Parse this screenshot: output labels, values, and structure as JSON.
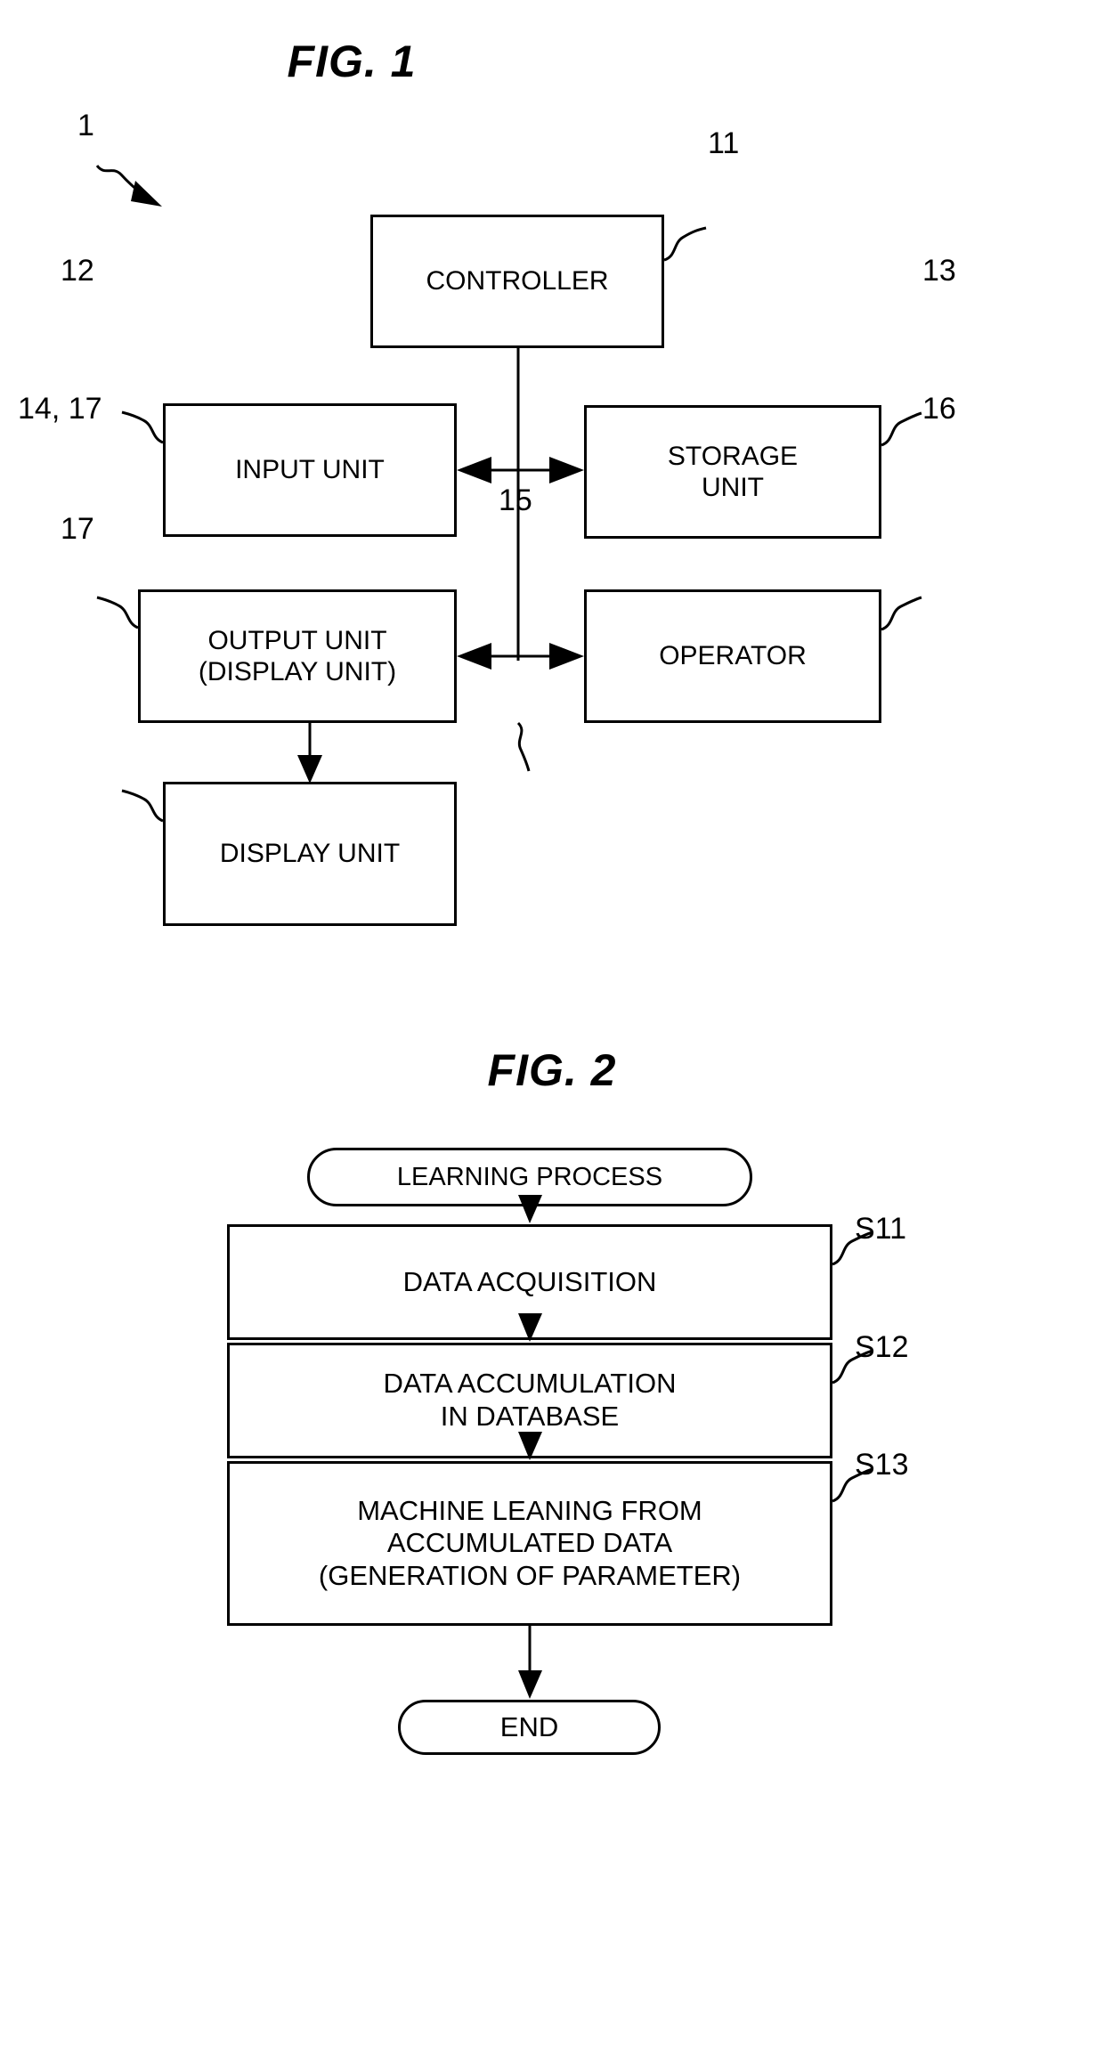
{
  "figures": [
    {
      "title": "FIG. 1",
      "type": "block-diagram",
      "system_ref": "1",
      "blocks": [
        {
          "id": "controller",
          "label": "CONTROLLER",
          "ref": "11"
        },
        {
          "id": "input-unit",
          "label": "INPUT UNIT",
          "ref": "12"
        },
        {
          "id": "storage-unit",
          "label": "STORAGE\nUNIT",
          "ref": "13"
        },
        {
          "id": "output-unit",
          "label": "OUTPUT UNIT\n(DISPLAY UNIT)",
          "ref": "14, 17"
        },
        {
          "id": "operator",
          "label": "OPERATOR",
          "ref": "16"
        },
        {
          "id": "display-unit",
          "label": "DISPLAY UNIT",
          "ref": "17"
        }
      ],
      "bus_ref": "15"
    },
    {
      "title": "FIG. 2",
      "type": "flowchart",
      "start_label": "LEARNING PROCESS",
      "end_label": "END",
      "steps": [
        {
          "id": "s11",
          "label": "DATA ACQUISITION",
          "ref": "S11"
        },
        {
          "id": "s12",
          "label": "DATA ACCUMULATION\nIN DATABASE",
          "ref": "S12"
        },
        {
          "id": "s13",
          "label": "MACHINE LEANING FROM\nACCUMULATED DATA\n(GENERATION OF PARAMETER)",
          "ref": "S13"
        }
      ]
    }
  ],
  "colors": {
    "line": "#000000",
    "background": "#ffffff"
  }
}
